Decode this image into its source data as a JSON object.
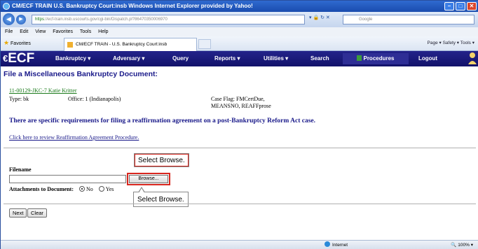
{
  "window": {
    "title": "CM/ECF TRAIN   U.S. Bankruptcy Court:insb   Windows Internet Explorer provided by Yahoo!",
    "minimize": "–",
    "maximize": "□",
    "close": "✕"
  },
  "address": {
    "url_scheme": "https",
    "url_host": "://ecf-train.insb.uscourts.gov/",
    "url_rest": "cgi-bin/Dispatch.pl?86470350006970",
    "search_placeholder": "Google"
  },
  "menubar": {
    "items": [
      "File",
      "Edit",
      "View",
      "Favorites",
      "Tools",
      "Help"
    ]
  },
  "favorites": {
    "label": "Favorites",
    "tab_title": "CM/ECF TRAIN - U.S. Bankruptcy Court:insb",
    "commands": "Page ▾   Safety ▾   Tools ▾"
  },
  "ecf": {
    "logo": "ECF",
    "logo_prefix": "€",
    "menu": {
      "bankruptcy": "Bankruptcy ▾",
      "adversary": "Adversary ▾",
      "query": "Query",
      "reports": "Reports ▾",
      "utilities": "Utilities ▾",
      "search": "Search",
      "procedures": "Procedures",
      "logout": "Logout"
    }
  },
  "page": {
    "title": "File a Miscellaneous Bankruptcy Document:",
    "case_link": "11-00129-JKC-7 Katie Kritter",
    "type": "Type: bk",
    "office": "Office: 1 (Indianapolis)",
    "case_flag_line1": "Case Flag: FMCertDue,",
    "case_flag_line2": "MEANSNO, REAFFprose",
    "warning": "There are specific requirements for filing a reaffirmation agreement on a post-Bankruptcy Reform Act case.",
    "review_link": "Click here to review Reaffirmation Agreement Procedure.",
    "filename_label": "Filename",
    "filename_value": "",
    "browse_label": "Browse...",
    "attachments_label": "Attachments to Document:",
    "attach_no": "No",
    "attach_yes": "Yes",
    "attach_selected": "No",
    "next_label": "Next",
    "clear_label": "Clear"
  },
  "callouts": {
    "top": "Select Browse.",
    "bottom": "Select Browse."
  },
  "status": {
    "zone": "Internet",
    "zoom": "100%"
  }
}
